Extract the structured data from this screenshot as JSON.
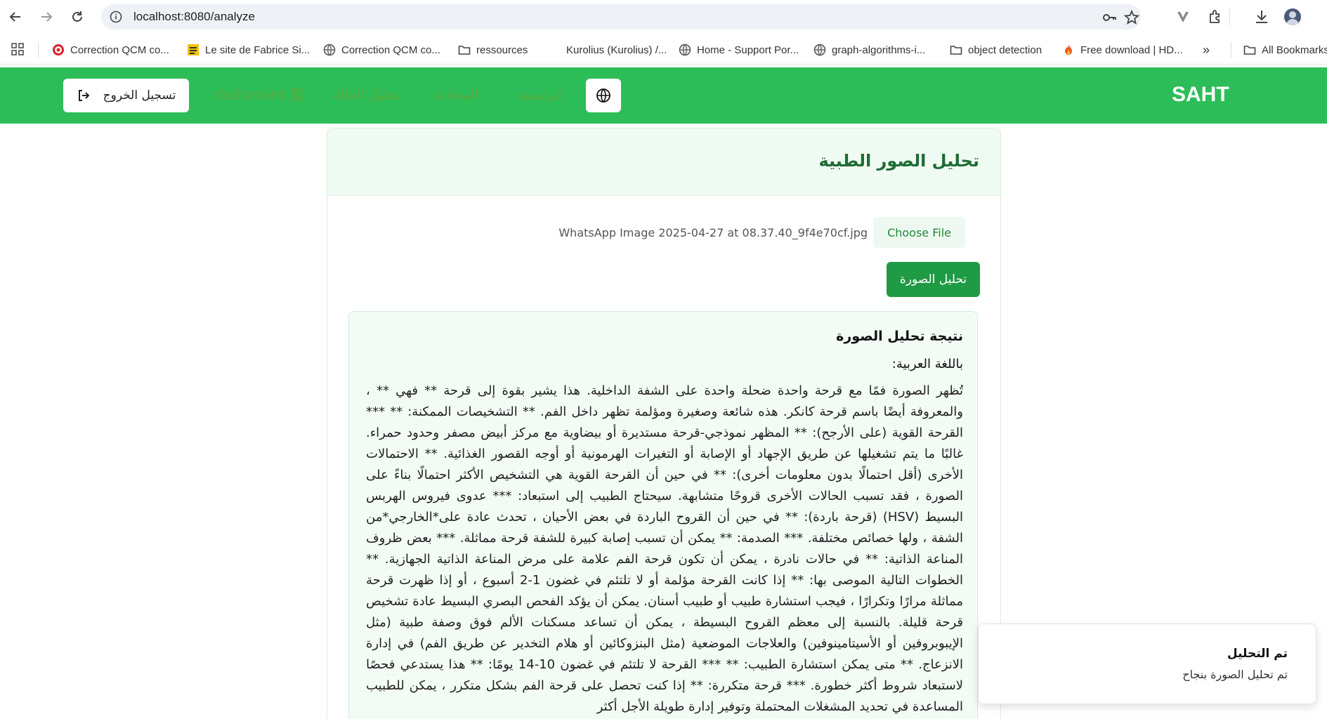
{
  "browser": {
    "url": "localhost:8080/analyze",
    "bookmarks": [
      {
        "label": "Correction QCM co...",
        "icon": "target-icon"
      },
      {
        "label": "Le site de Fabrice Si...",
        "icon": "site-icon"
      },
      {
        "label": "Correction QCM co...",
        "icon": "globe-icon"
      },
      {
        "label": "ressources",
        "icon": "folder-icon"
      },
      {
        "label": "Kurolius (Kurolius) /...",
        "icon": "blank-icon"
      },
      {
        "label": "Home - Support Por...",
        "icon": "globe-icon"
      },
      {
        "label": "graph-algorithms-i...",
        "icon": "globe-icon"
      },
      {
        "label": "object detection",
        "icon": "folder-icon"
      },
      {
        "label": "Free download | HD...",
        "icon": "flame-icon"
      },
      {
        "label": "All Bookmarks",
        "icon": "folder-icon"
      }
    ],
    "more_label": "»"
  },
  "header": {
    "brand": "SAHT",
    "logout_label": "تسجيل الخروج",
    "nav": {
      "dashboard": "dashboard",
      "case_analysis": "تحليل الحالة",
      "chat": "المحادثة",
      "home": "الرئيسية"
    }
  },
  "card": {
    "title": "تحليل الصور الطبية",
    "file_name": "WhatsApp Image 2025-04-27 at 08.37.40_9f4e70cf.jpg",
    "choose_file_label": "Choose File",
    "analyze_label": "تحليل الصورة",
    "result": {
      "title": "نتيجة تحليل الصورة",
      "subtitle": "باللغة العربية:",
      "text": "تُظهر الصورة فمًا مع قرحة واحدة ضحلة واحدة على الشفة الداخلية. هذا يشير بقوة إلى قرحة ** فهي ** ، والمعروفة أيضًا باسم قرحة كانكر. هذه شائعة وصغيرة ومؤلمة تظهر داخل الفم. ** التشخيصات الممكنة: ** *** القرحة القوية (على الأرجح): ** المظهر نموذجي-قرحة مستديرة أو بيضاوية مع مركز أبيض مصفر وحدود حمراء. غالبًا ما يتم تشغيلها عن طريق الإجهاد أو الإصابة أو التغيرات الهرمونية أو أوجه القصور الغذائية. ** الاحتمالات الأخرى (أقل احتمالًا بدون معلومات أخرى): ** في حين أن القرحة القوية هي التشخيص الأكثر احتمالًا بناءً على الصورة ، فقد تسبب الحالات الأخرى قروحًا متشابهة. سيحتاج الطبيب إلى استبعاد: *** عدوى فيروس الهربس البسيط (HSV) (قرحة باردة): ** في حين أن القروح الباردة في بعض الأحيان ، تحدث عادة على*الخارجي*من الشفة ، ولها خصائص مختلفة. *** الصدمة: ** يمكن أن تسبب إصابة كبيرة للشفة قرحة مماثلة. *** بعض ظروف المناعة الذاتية: ** في حالات نادرة ، يمكن أن تكون قرحة الفم علامة على مرض المناعة الذاتية الجهازية. ** الخطوات التالية الموصى بها: ** إذا كانت القرحة مؤلمة أو لا تلتئم في غضون 1-2 أسبوع ، أو إذا ظهرت قرحة مماثلة مرارًا وتكرارًا ، فيجب استشارة طبيب أو طبيب أسنان. يمكن أن يؤكد الفحص البصري البسيط عادة تشخيص قرحة قليلة. بالنسبة إلى معظم القروح البسيطة ، يمكن أن تساعد مسكنات الألم فوق وصفة طبية (مثل الإيبوبروفين أو الأسيتامينوفين) والعلاجات الموضعية (مثل البنزوكائين أو هلام التخدير عن طريق الفم) في إدارة الانزعاج. ** متى يمكن استشارة الطبيب: ** *** القرحة لا تلتئم في غضون 10-14 يومًا: ** هذا يستدعي فحصًا لاستبعاد شروط أكثر خطورة. *** قرحة متكررة: ** إذا كنت تحصل على قرحة الفم بشكل متكرر ، يمكن للطبيب المساعدة في تحديد المشغلات المحتملة وتوفير إدارة طويلة الأجل أكثر"
    }
  },
  "toast": {
    "title": "تم التحليل",
    "description": "تم تحليل الصورة بنجاح"
  },
  "colors": {
    "header_green": "#2dbd58",
    "button_green": "#1f9a45",
    "nav_text": "#56a83a",
    "title_green": "#1e6b32"
  }
}
